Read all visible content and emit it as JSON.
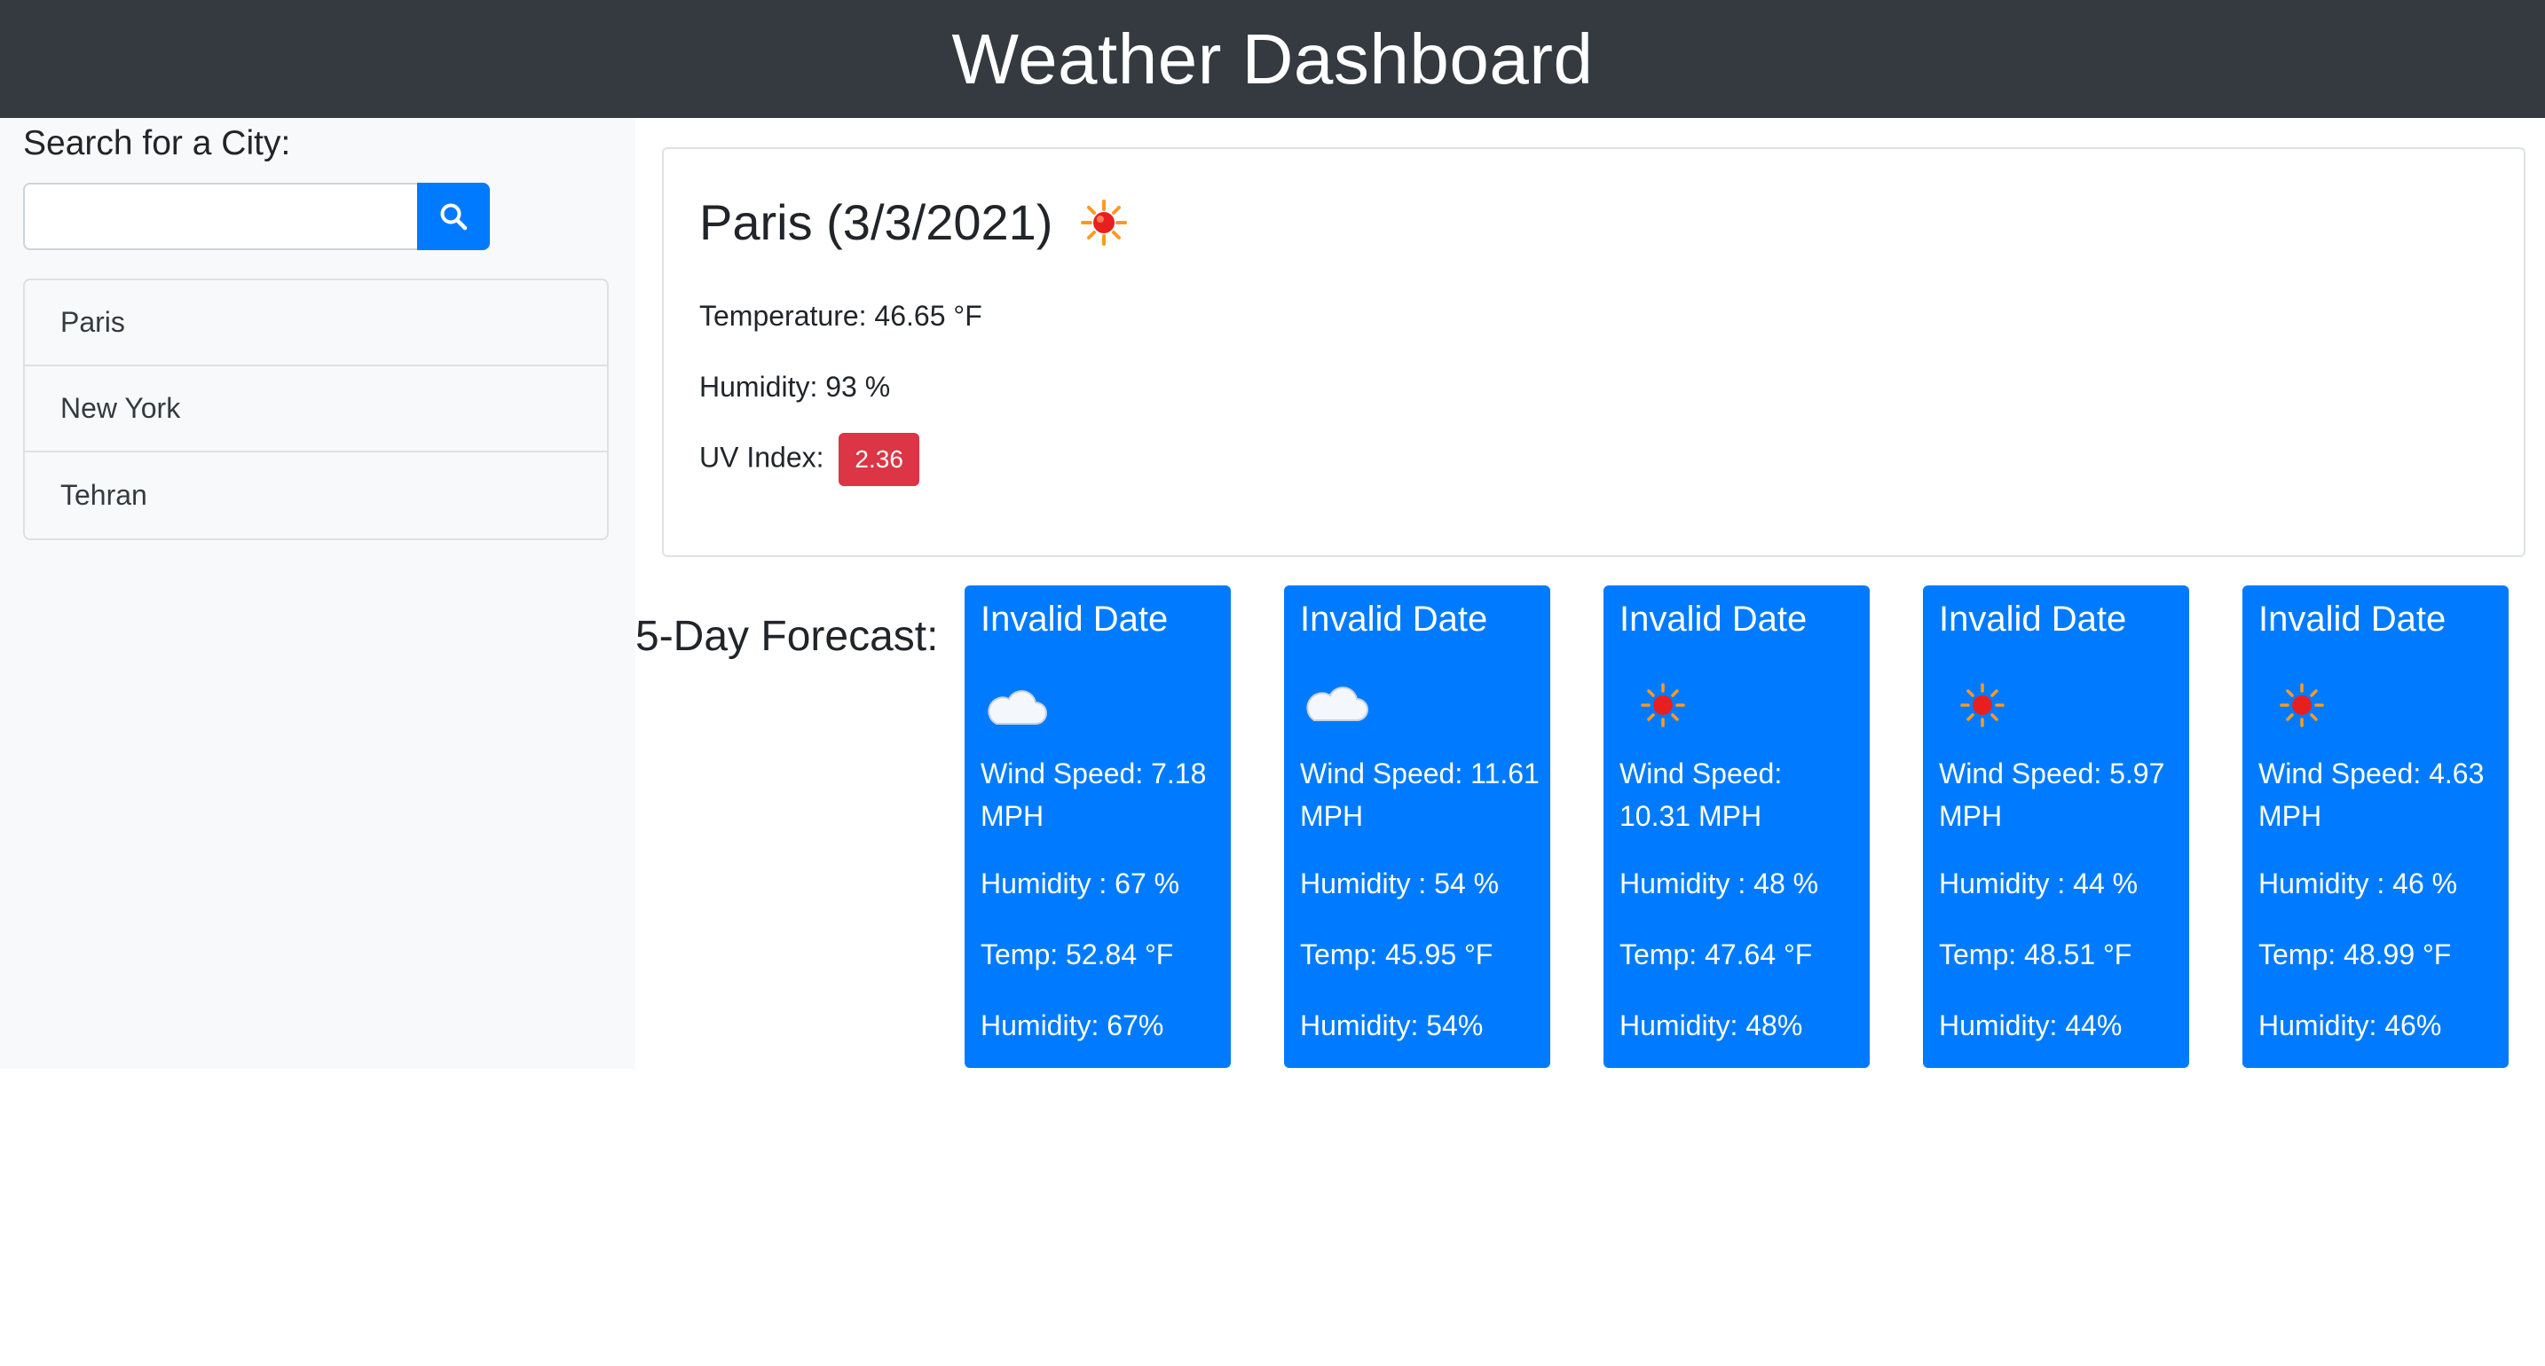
{
  "header": {
    "title": "Weather Dashboard"
  },
  "sidebar": {
    "search_label": "Search for a City:",
    "search_value": "",
    "cities": [
      "Paris",
      "New York",
      "Tehran"
    ]
  },
  "current": {
    "title": "Paris (3/3/2021)",
    "icon": "sun-icon",
    "temperature": "Temperature: 46.65 °F",
    "humidity": "Humidity: 93 %",
    "uv_label": "UV Index:",
    "uv_value": "2.36"
  },
  "forecast": {
    "title": "5-Day Forecast:",
    "days": [
      {
        "date": "Invalid Date",
        "icon": "cloud-moon-icon",
        "wind": "Wind Speed: 7.18 MPH",
        "humidity_a": "Humidity : 67 %",
        "temp": "Temp: 52.84 °F",
        "humidity_b": "Humidity: 67%"
      },
      {
        "date": "Invalid Date",
        "icon": "cloud-icon",
        "wind": "Wind Speed: 11.61 MPH",
        "humidity_a": "Humidity : 54 %",
        "temp": "Temp: 45.95 °F",
        "humidity_b": "Humidity: 54%"
      },
      {
        "date": "Invalid Date",
        "icon": "sun-icon",
        "wind": "Wind Speed: 10.31 MPH",
        "humidity_a": "Humidity : 48 %",
        "temp": "Temp: 47.64 °F",
        "humidity_b": "Humidity: 48%"
      },
      {
        "date": "Invalid Date",
        "icon": "sun-icon",
        "wind": "Wind Speed: 5.97 MPH",
        "humidity_a": "Humidity : 44 %",
        "temp": "Temp: 48.51 °F",
        "humidity_b": "Humidity: 44%"
      },
      {
        "date": "Invalid Date",
        "icon": "sun-icon",
        "wind": "Wind Speed: 4.63 MPH",
        "humidity_a": "Humidity : 46 %",
        "temp": "Temp: 48.99 °F",
        "humidity_b": "Humidity: 46%"
      }
    ]
  },
  "colors": {
    "header": "#343a40",
    "accent": "#007bff",
    "uv_badge": "#dc3545"
  }
}
